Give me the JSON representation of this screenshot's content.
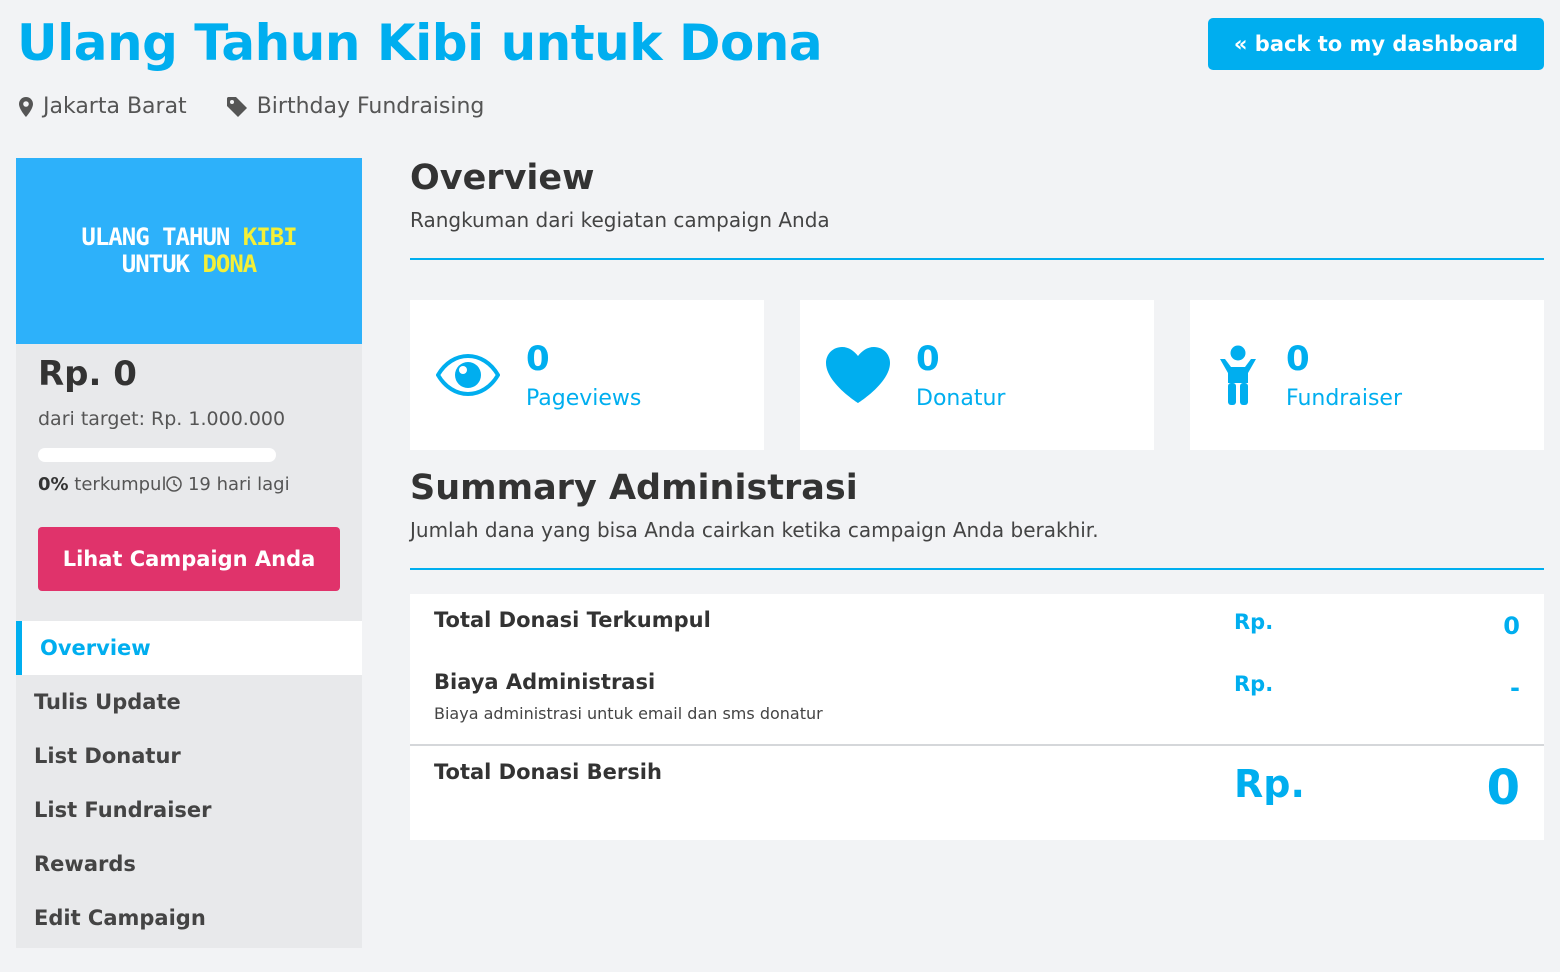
{
  "header": {
    "title": "Ulang Tahun Kibi untuk Dona",
    "location": "Jakarta Barat",
    "category": "Birthday Fundraising",
    "back_button": "« back to my dashboard"
  },
  "sidebar": {
    "banner": {
      "line1_a": "ULANG TAHUN ",
      "line1_b": "KIBI",
      "line2_a": "UNTUK ",
      "line2_b": "DONA",
      "bg_color": "#2db1fa",
      "highlight_color": "#f4ef37"
    },
    "raised": "Rp. 0",
    "target": "dari target: Rp. 1.000.000",
    "progress_percent": 0,
    "progress_label": "0%",
    "progress_collected": " terkumpul",
    "days_left": "19 hari lagi",
    "view_button": "Lihat Campaign Anda",
    "nav": [
      {
        "label": "Overview",
        "active": true
      },
      {
        "label": "Tulis Update",
        "active": false
      },
      {
        "label": "List Donatur",
        "active": false
      },
      {
        "label": "List Fundraiser",
        "active": false
      },
      {
        "label": "Rewards",
        "active": false
      },
      {
        "label": "Edit Campaign",
        "active": false
      }
    ]
  },
  "overview": {
    "title": "Overview",
    "subtitle": "Rangkuman dari kegiatan campaign Anda",
    "stats": [
      {
        "icon": "eye-icon",
        "value": "0",
        "label": "Pageviews"
      },
      {
        "icon": "heart-icon",
        "value": "0",
        "label": "Donatur"
      },
      {
        "icon": "person-icon",
        "value": "0",
        "label": "Fundraiser"
      }
    ]
  },
  "summary": {
    "title": "Summary Administrasi",
    "subtitle": "Jumlah dana yang bisa Anda cairkan ketika campaign Anda berakhir.",
    "rows": [
      {
        "label": "Total Donasi Terkumpul",
        "note": "",
        "currency": "Rp.",
        "value": "0"
      },
      {
        "label": "Biaya Administrasi",
        "note": "Biaya administrasi untuk email dan sms donatur",
        "currency": "Rp.",
        "value": "-"
      },
      {
        "label": "Total Donasi Bersih",
        "note": "",
        "currency": "Rp.",
        "value": "0"
      }
    ]
  },
  "colors": {
    "accent": "#00aeef",
    "button_pink": "#e0336b",
    "background": "#f2f3f5"
  }
}
